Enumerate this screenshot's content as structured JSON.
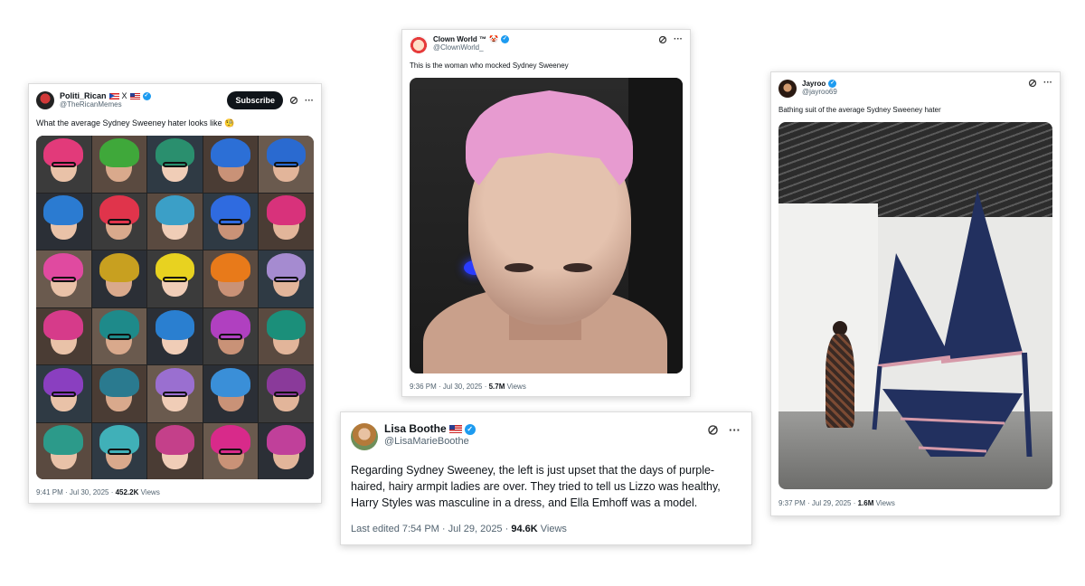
{
  "tweets": [
    {
      "display_name": "Politi_Rican",
      "handle": "@TheRicanMemes",
      "name_suffix": "X",
      "subscribe_label": "Subscribe",
      "text": "What the average Sydney Sweeney hater looks like 🧐",
      "time": "9:41 PM · Jul 30, 2025 · ",
      "views_count": "452.2K",
      "views_label": " Views"
    },
    {
      "display_name": "Clown World ™",
      "handle": "@ClownWorld_",
      "name_emoji": "🤡",
      "text": "This is the woman who mocked Sydney Sweeney",
      "time": "9:36 PM · Jul 30, 2025 · ",
      "views_count": "5.7M",
      "views_label": " Views"
    },
    {
      "display_name": "Jayroo",
      "handle": "@jayroo69",
      "text": "Bathing suit of the average Sydney Sweeney hater",
      "time": "9:37 PM · Jul 29, 2025 · ",
      "views_count": "1.6M",
      "views_label": " Views"
    },
    {
      "display_name": "Lisa Boothe",
      "handle": "@LisaMarieBoothe",
      "text": "Regarding Sydney Sweeney, the left is just upset that the days of purple-haired, hairy armpit ladies are over. They tried to tell us Lizzo was healthy, Harry Styles was masculine in a dress, and Ella Emhoff was a model.",
      "time": "Last edited 7:54 PM · Jul 29, 2025 · ",
      "views_count": "94.6K",
      "views_label": " Views"
    }
  ],
  "icons": {
    "verified": "✓",
    "grok": "grok-icon",
    "more": "···"
  },
  "colors": {
    "verified_blue": "#1d9bf0",
    "text": "#0f1419",
    "secondary_text": "#536471"
  },
  "hair_colors": [
    "#e23a7a",
    "#3fa83a",
    "#2a8f6e",
    "#2c6fd6",
    "#2a6ad0",
    "#2b7bd1",
    "#e0344b",
    "#3b9fc7",
    "#2f6be0",
    "#d8327b",
    "#e04aa0",
    "#c8a020",
    "#e8d220",
    "#e87a1a",
    "#a58bd0",
    "#d63b8a",
    "#1e8a8a",
    "#2a7fd0",
    "#b040c0",
    "#1b8f7a",
    "#8a3fc0",
    "#2a7a8f",
    "#9a6fd0",
    "#3a8fd8",
    "#8a3a9a",
    "#2c9a8a",
    "#40b0b8",
    "#c4408a",
    "#d82a8a",
    "#c0409a"
  ]
}
